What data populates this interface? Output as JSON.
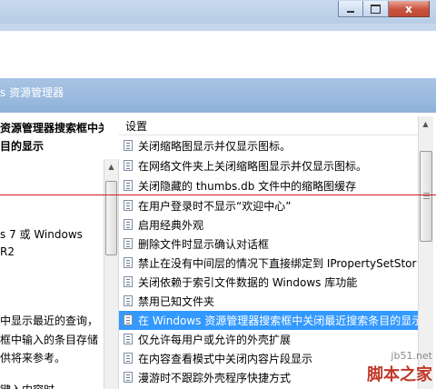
{
  "window": {
    "close_label": "x"
  },
  "banner": {
    "title": "s 资源管理器"
  },
  "left_pane": {
    "heading_line1": "资源管理器搜索框中关",
    "heading_line2": "目的显示",
    "req_line1": "s 7 或 Windows",
    "req_line2": "R2",
    "desc_line1": "中显示最近的查询，",
    "desc_line2": "框中输入的条目存储",
    "desc_line3": "供将来参考。",
    "desc_line4": "键入内容时"
  },
  "settings_list": {
    "header": "设置",
    "items": [
      {
        "label": "关闭缩略图显示并仅显示图标。",
        "selected": false
      },
      {
        "label": "在网络文件夹上关闭缩略图显示并仅显示图标。",
        "selected": false
      },
      {
        "label": "关闭隐藏的 thumbs.db 文件中的缩略图缓存",
        "selected": false
      },
      {
        "label": "在用户登录时不显示“欢迎中心”",
        "selected": false
      },
      {
        "label": "启用经典外观",
        "selected": false
      },
      {
        "label": "删除文件时显示确认对话框",
        "selected": false
      },
      {
        "label": "禁止在没有中间层的情况下直接绑定到 IPropertySetStor",
        "selected": false
      },
      {
        "label": "关闭依赖于索引文件数据的 Windows 库功能",
        "selected": false
      },
      {
        "label": "禁用已知文件夹",
        "selected": false
      },
      {
        "label": "在 Windows 资源管理器搜索框中关闭最近搜索条目的显示",
        "selected": true
      },
      {
        "label": "仅允许每用户或允许的外壳扩展",
        "selected": false
      },
      {
        "label": "在内容查看模式中关闭内容片段显示",
        "selected": false
      },
      {
        "label": "漫游时不跟踪外壳程序快捷方式",
        "selected": false
      }
    ]
  },
  "watermark": {
    "url": "jb51.net",
    "name": "脚本之家"
  },
  "colors": {
    "selection": "#3399ff",
    "banner": "#9bbbe0",
    "annotation_line": "#d21c1c"
  }
}
